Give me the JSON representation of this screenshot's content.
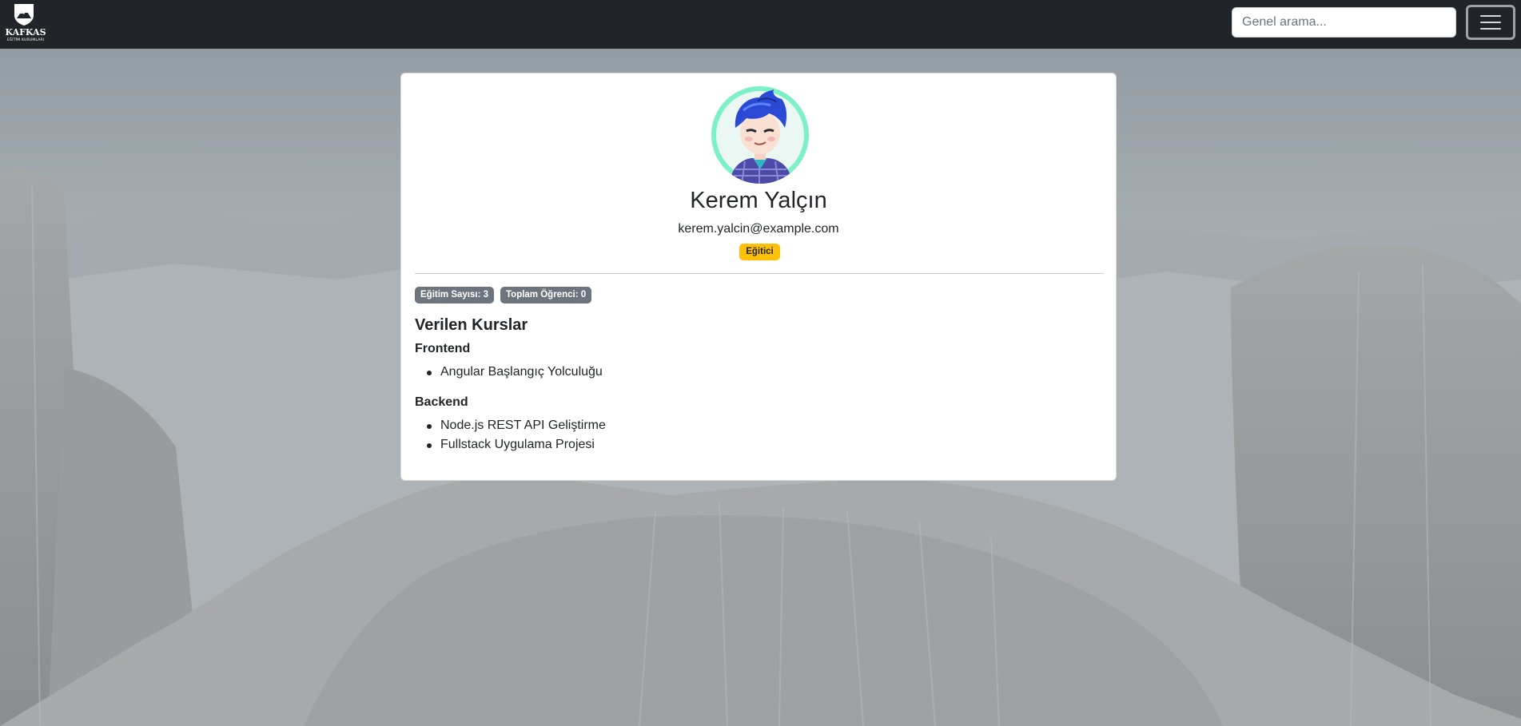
{
  "navbar": {
    "brand": {
      "name": "KAFKAS",
      "subtitle": "EĞİTİM KURUMLARI",
      "logo_icon": "mountain-shield-icon"
    },
    "search": {
      "placeholder": "Genel arama...",
      "value": ""
    },
    "menu_toggle_icon": "hamburger-menu-icon"
  },
  "profile": {
    "avatar_icon": "user-avatar",
    "name": "Kerem Yalçın",
    "email": "kerem.yalcin@example.com",
    "role": "Eğitici",
    "stats": {
      "course_count": "Eğitim Sayısı: 3",
      "student_count": "Toplam Öğrenci: 0"
    }
  },
  "courses": {
    "title": "Verilen Kurslar",
    "groups": [
      {
        "name": "Frontend",
        "items": [
          "Angular Başlangıç Yolculuğu"
        ]
      },
      {
        "name": "Backend",
        "items": [
          "Node.js REST API Geliştirme",
          "Fullstack Uygulama Projesi"
        ]
      }
    ]
  },
  "colors": {
    "navbar": "#212529",
    "role_badge": "#ffc107",
    "stat_badge": "#6c757d",
    "avatar_ring": "#7ef0c8"
  }
}
